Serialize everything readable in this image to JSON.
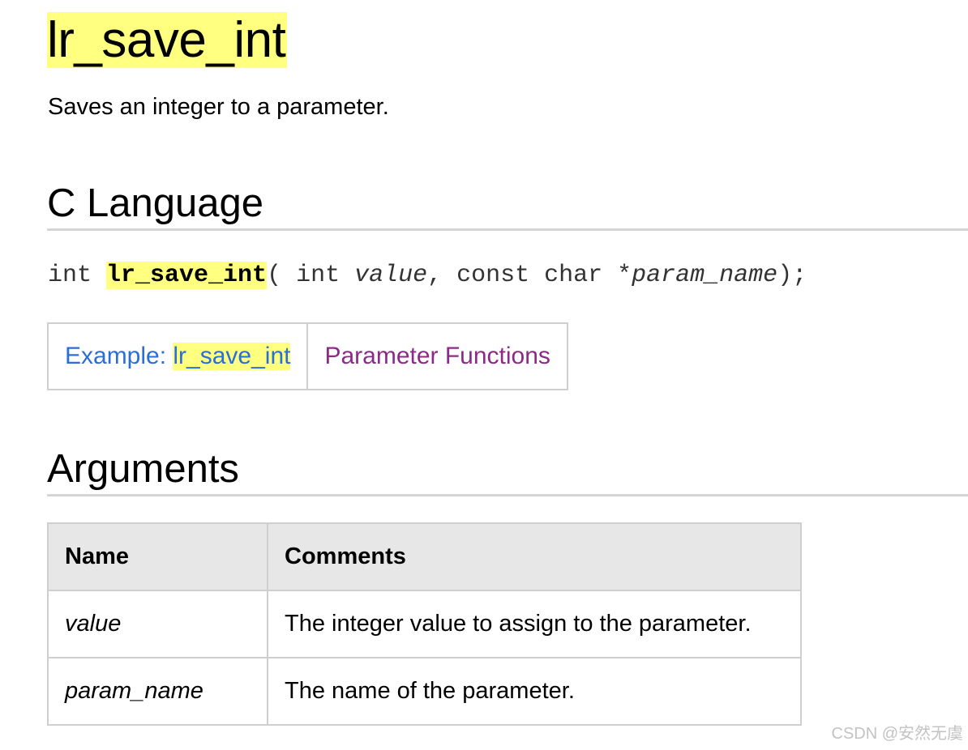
{
  "title": "lr_save_int",
  "summary": "Saves an integer to a parameter.",
  "sections": {
    "c_language": "C Language",
    "arguments": "Arguments"
  },
  "signature": {
    "return_type": "int ",
    "function_name": "lr_save_int",
    "open": "( int ",
    "param1": "value",
    "middle": ", const char *",
    "param2": "param_name",
    "close": ");"
  },
  "links": {
    "example_prefix": "Example: ",
    "example_name": "lr_save_int",
    "parameter_functions": "Parameter Functions"
  },
  "table": {
    "headers": [
      "Name",
      "Comments"
    ],
    "rows": [
      {
        "name": "value",
        "comment": "The integer value to assign to the parameter."
      },
      {
        "name": "param_name",
        "comment": "The name of the parameter."
      }
    ]
  },
  "watermark": "CSDN @安然无虞",
  "colors": {
    "highlight": "#ffff80",
    "link": "#2a6ed8",
    "visited_link": "#8c2a88",
    "table_header_bg": "#e6e7e6"
  }
}
